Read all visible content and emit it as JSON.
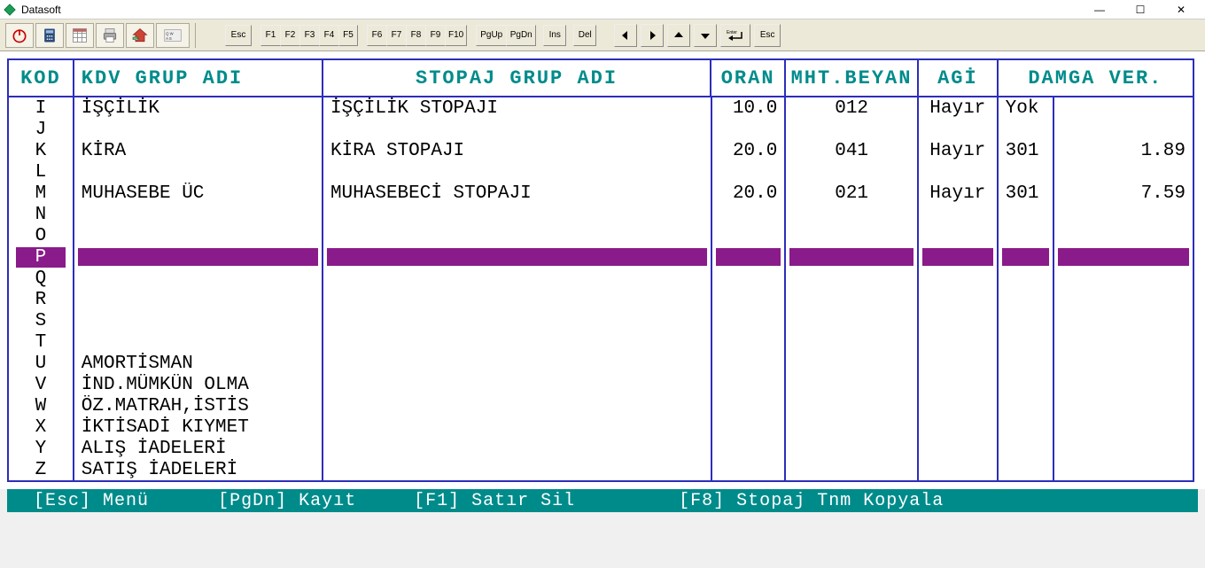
{
  "window": {
    "title": "Datasoft"
  },
  "toolbar": {
    "icons": [
      "power",
      "calculator",
      "grid",
      "printer",
      "home"
    ],
    "key_labels": {
      "esc": "Esc",
      "f1": "F1",
      "f2": "F2",
      "f3": "F3",
      "f4": "F4",
      "f5": "F5",
      "f6": "F6",
      "f7": "F7",
      "f8": "F8",
      "f9": "F9",
      "f10": "F10",
      "pgup": "PgUp",
      "pgdn": "PgDn",
      "ins": "Ins",
      "del": "Del",
      "enter": "Enter",
      "esc2": "Esc"
    }
  },
  "headers": {
    "kod": "KOD",
    "kdv": "KDV GRUP ADI",
    "stopaj": "STOPAJ GRUP ADI",
    "oran": "ORAN",
    "mht": "MHT.BEYAN",
    "agi": "AGİ",
    "damga": "DAMGA VER."
  },
  "kod_letters": [
    "I",
    "J",
    "K",
    "L",
    "M",
    "N",
    "O",
    "P",
    "Q",
    "R",
    "S",
    "T",
    "U",
    "V",
    "W",
    "X",
    "Y",
    "Z"
  ],
  "selected_kod": "P",
  "rows": {
    "I": {
      "kdv": "İŞÇİLİK",
      "stopaj": "İŞÇİLİK STOPAJI",
      "oran": "10.0",
      "mht": "012",
      "agi": "Hayır",
      "damga1": "Yok",
      "damga2": ""
    },
    "J": {
      "kdv": "",
      "stopaj": "",
      "oran": "",
      "mht": "",
      "agi": "",
      "damga1": "",
      "damga2": ""
    },
    "K": {
      "kdv": "KİRA",
      "stopaj": "KİRA STOPAJI",
      "oran": "20.0",
      "mht": "041",
      "agi": "Hayır",
      "damga1": "301",
      "damga2": "1.89"
    },
    "L": {
      "kdv": "",
      "stopaj": "",
      "oran": "",
      "mht": "",
      "agi": "",
      "damga1": "",
      "damga2": ""
    },
    "M": {
      "kdv": "MUHASEBE ÜC",
      "stopaj": "MUHASEBECİ STOPAJI",
      "oran": "20.0",
      "mht": "021",
      "agi": "Hayır",
      "damga1": "301",
      "damga2": "7.59"
    },
    "N": {
      "kdv": "",
      "stopaj": "",
      "oran": "",
      "mht": "",
      "agi": "",
      "damga1": "",
      "damga2": ""
    },
    "O": {
      "kdv": "",
      "stopaj": "",
      "oran": "",
      "mht": "",
      "agi": "",
      "damga1": "",
      "damga2": ""
    },
    "P": {
      "highlight": true
    },
    "Q": {
      "kdv": "",
      "stopaj": "",
      "oran": "",
      "mht": "",
      "agi": "",
      "damga1": "",
      "damga2": ""
    },
    "R": {
      "kdv": "",
      "stopaj": "",
      "oran": "",
      "mht": "",
      "agi": "",
      "damga1": "",
      "damga2": ""
    },
    "S": {
      "kdv": "",
      "stopaj": "",
      "oran": "",
      "mht": "",
      "agi": "",
      "damga1": "",
      "damga2": ""
    },
    "T": {
      "kdv": "",
      "stopaj": "",
      "oran": "",
      "mht": "",
      "agi": "",
      "damga1": "",
      "damga2": ""
    },
    "U": {
      "kdv": "AMORTİSMAN",
      "stopaj": "",
      "oran": "",
      "mht": "",
      "agi": "",
      "damga1": "",
      "damga2": ""
    },
    "V": {
      "kdv": "İND.MÜMKÜN OLMA",
      "stopaj": "",
      "oran": "",
      "mht": "",
      "agi": "",
      "damga1": "",
      "damga2": ""
    },
    "W": {
      "kdv": "ÖZ.MATRAH,İSTİS",
      "stopaj": "",
      "oran": "",
      "mht": "",
      "agi": "",
      "damga1": "",
      "damga2": ""
    },
    "X": {
      "kdv": "İKTİSADİ KIYMET",
      "stopaj": "",
      "oran": "",
      "mht": "",
      "agi": "",
      "damga1": "",
      "damga2": ""
    },
    "Y": {
      "kdv": "ALIŞ İADELERİ",
      "stopaj": "",
      "oran": "",
      "mht": "",
      "agi": "",
      "damga1": "",
      "damga2": ""
    },
    "Z": {
      "kdv": "SATIŞ İADELERİ",
      "stopaj": "",
      "oran": "",
      "mht": "",
      "agi": "",
      "damga1": "",
      "damga2": ""
    }
  },
  "helpbar": {
    "esc": "[Esc] Menü",
    "pgdn": "[PgDn] Kayıt",
    "f1": "[F1] Satır Sil",
    "f8": "[F8] Stopaj Tnm Kopyala"
  }
}
